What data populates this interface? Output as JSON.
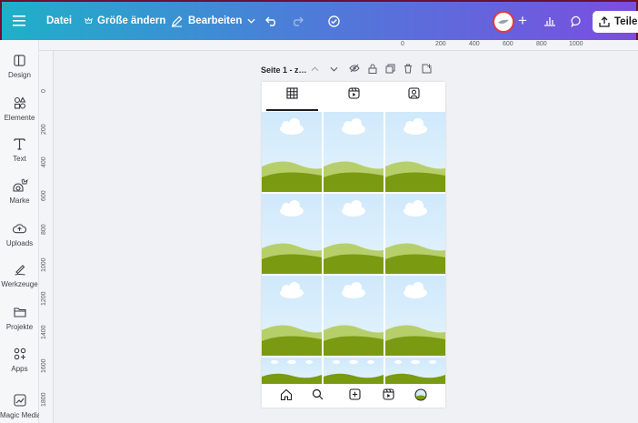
{
  "topbar": {
    "menu_icon": "hamburger-icon",
    "file_label": "Datei",
    "resize_label": "Größe ändern",
    "edit_label": "Bearbeiten",
    "share_label": "Teilen",
    "gradient_colors": [
      "#1fb0c9",
      "#4a7fd8",
      "#7a4ee0"
    ]
  },
  "sidebar": {
    "items": [
      {
        "label": "Design",
        "icon": "design-icon"
      },
      {
        "label": "Elemente",
        "icon": "elements-icon"
      },
      {
        "label": "Text",
        "icon": "text-icon"
      },
      {
        "label": "Marke",
        "icon": "brand-icon"
      },
      {
        "label": "Uploads",
        "icon": "upload-icon"
      },
      {
        "label": "Werkzeuge",
        "icon": "tools-icon"
      },
      {
        "label": "Projekte",
        "icon": "folder-icon"
      },
      {
        "label": "Apps",
        "icon": "apps-icon"
      },
      {
        "label": "Magic Media",
        "icon": "magic-media-icon"
      }
    ]
  },
  "ruler_top": [
    "0",
    "200",
    "400",
    "600",
    "800",
    "1000"
  ],
  "ruler_left": [
    "0",
    "200",
    "400",
    "600",
    "800",
    "1000",
    "1200",
    "1400",
    "1600",
    "1800"
  ],
  "page": {
    "title": "Seite 1 - z…"
  },
  "accent_colors": {
    "hill_dark": "#7a9a12",
    "hill_light": "#b7cf6a",
    "sky": "#d6edfb"
  }
}
